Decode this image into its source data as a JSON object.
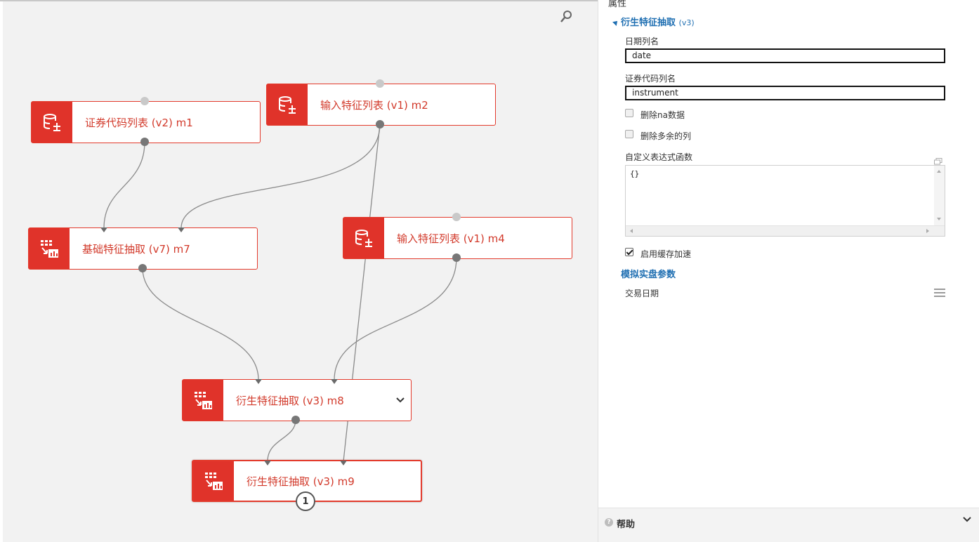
{
  "canvas": {
    "nodes": [
      {
        "id": "m1",
        "label": "证券代码列表 (v2) m1",
        "icon": "data-source-icon"
      },
      {
        "id": "m2",
        "label": "输入特征列表 (v1) m2",
        "icon": "data-source-icon"
      },
      {
        "id": "m7",
        "label": "基础特征抽取 (v7) m7",
        "icon": "feature-extract-icon"
      },
      {
        "id": "m4",
        "label": "输入特征列表 (v1) m4",
        "icon": "data-source-icon"
      },
      {
        "id": "m8",
        "label": "衍生特征抽取 (v3) m8",
        "icon": "feature-extract-icon"
      },
      {
        "id": "m9",
        "label": "衍生特征抽取 (v3) m9",
        "icon": "feature-extract-icon"
      }
    ],
    "m9_badge": "1",
    "zoom_icon": "search-icon",
    "accent_color": "#e0332a"
  },
  "panel": {
    "title": "属性",
    "section_title": "衍生特征抽取",
    "section_version": "(v3)",
    "date_col_label": "日期列名",
    "date_col_value": "date",
    "instrument_col_label": "证券代码列名",
    "instrument_col_value": "instrument",
    "drop_na_label": "删除na数据",
    "drop_na_checked": false,
    "remove_extra_label": "删除多余的列",
    "remove_extra_checked": false,
    "user_functions_label": "自定义表达式函数",
    "user_functions_value": "{}",
    "cache_label": "启用缓存加速",
    "cache_checked": true,
    "sim_title": "模拟实盘参数",
    "trade_date_label": "交易日期",
    "help_label": "帮助",
    "link_color": "#1f6fb2"
  }
}
